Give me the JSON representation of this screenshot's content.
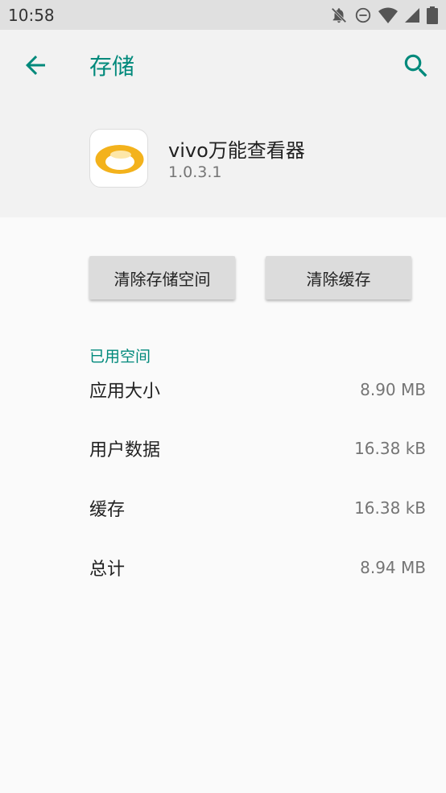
{
  "status_bar": {
    "time": "10:58",
    "icons": [
      "notifications-off-icon",
      "do-not-disturb-icon",
      "wifi-icon",
      "cellular-signal-icon",
      "battery-icon"
    ]
  },
  "app_bar": {
    "title": "存储",
    "accent_color": "#00897b"
  },
  "app_info": {
    "name": "vivo万能查看器",
    "version": "1.0.3.1",
    "icon": "vivo-viewer-app-icon"
  },
  "buttons": {
    "clear_storage": "清除存储空间",
    "clear_cache": "清除缓存"
  },
  "used_space": {
    "header": "已用空间",
    "rows": [
      {
        "label": "应用大小",
        "value": "8.90 MB"
      },
      {
        "label": "用户数据",
        "value": "16.38 kB"
      },
      {
        "label": "缓存",
        "value": "16.38 kB"
      },
      {
        "label": "总计",
        "value": "8.94 MB"
      }
    ]
  }
}
